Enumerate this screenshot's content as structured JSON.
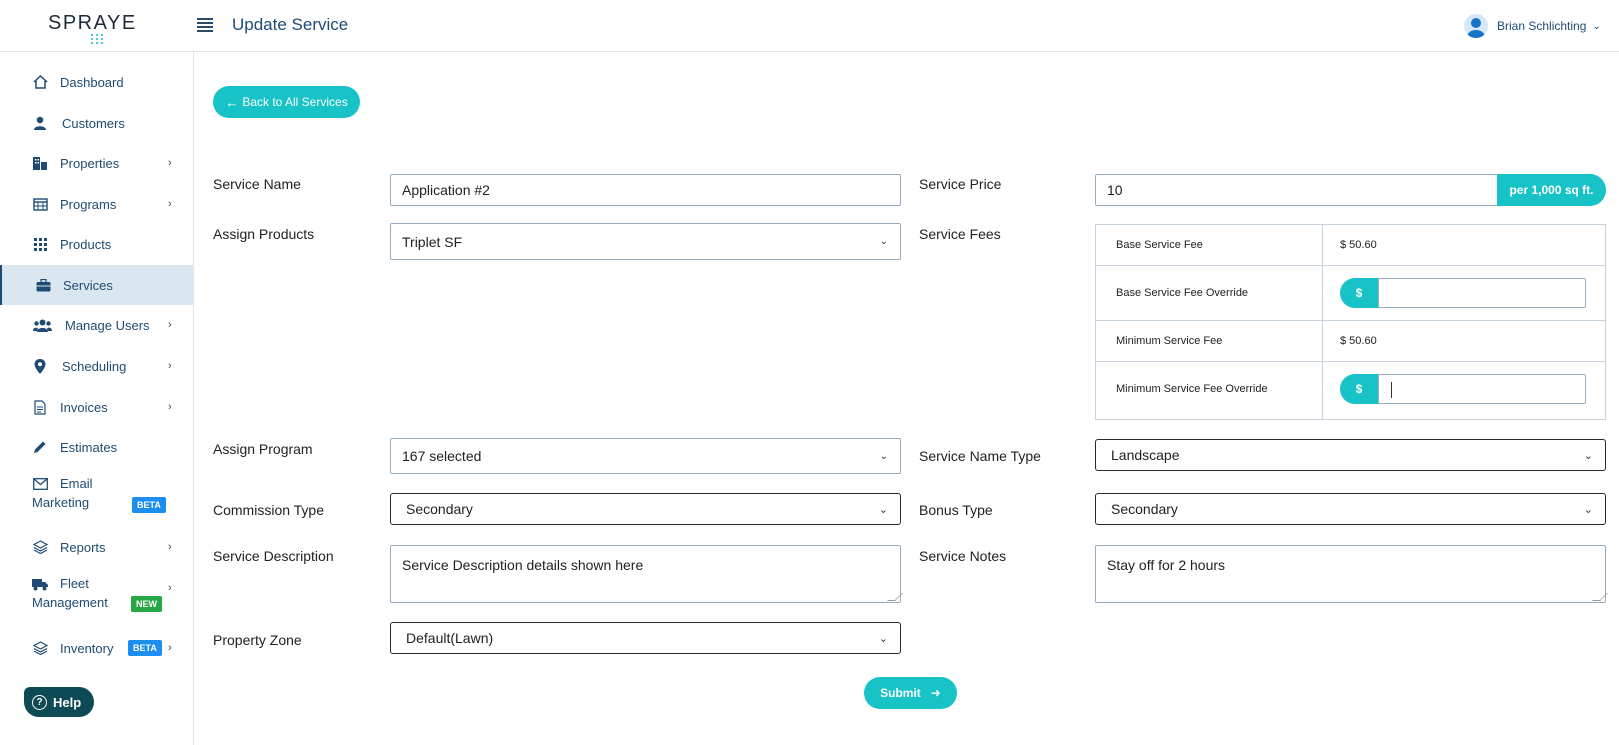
{
  "header": {
    "logo": "SPRAYE",
    "title": "Update Service",
    "user_name": "Brian Schlichting"
  },
  "sidebar": {
    "items": [
      {
        "label": "Dashboard"
      },
      {
        "label": "Customers"
      },
      {
        "label": "Properties"
      },
      {
        "label": "Programs"
      },
      {
        "label": "Products"
      },
      {
        "label": "Services"
      },
      {
        "label": "Manage Users"
      },
      {
        "label": "Scheduling"
      },
      {
        "label": "Invoices"
      },
      {
        "label": "Estimates"
      },
      {
        "label_line1": "Email",
        "label_line2": "Marketing",
        "badge": "BETA"
      },
      {
        "label": "Reports"
      },
      {
        "label_line1": "Fleet",
        "label_line2": "Management",
        "badge": "NEW"
      },
      {
        "label": "Inventory",
        "badge": "BETA"
      }
    ],
    "help": "Help"
  },
  "form": {
    "back_label": "Back to All Services",
    "service_name_label": "Service Name",
    "service_name_value": "Application #2",
    "service_price_label": "Service Price",
    "service_price_value": "10",
    "price_unit": "per 1,000 sq ft.",
    "assign_products_label": "Assign Products",
    "assign_products_value": "Triplet SF",
    "service_fees_label": "Service Fees",
    "fees": {
      "base_label": "Base Service Fee",
      "base_value": "$ 50.60",
      "base_override_label": "Base Service Fee Override",
      "min_label": "Minimum Service Fee",
      "min_value": "$ 50.60",
      "min_override_label": "Minimum Service Fee Override",
      "currency": "$"
    },
    "assign_program_label": "Assign Program",
    "assign_program_value": "167 selected",
    "service_name_type_label": "Service Name Type",
    "service_name_type_value": "Landscape",
    "commission_type_label": "Commission Type",
    "commission_type_value": "Secondary",
    "bonus_type_label": "Bonus Type",
    "bonus_type_value": "Secondary",
    "service_description_label": "Service Description",
    "service_description_value": "Service Description details shown here",
    "service_notes_label": "Service Notes",
    "service_notes_value": "Stay off for 2 hours",
    "property_zone_label": "Property Zone",
    "property_zone_value": "Default(Lawn)",
    "submit_label": "Submit"
  },
  "colors": {
    "accent": "#17c3c6",
    "nav_text": "#1f4b73",
    "active_bg": "#dae7f1",
    "help_bg": "#0e4a55",
    "beta_badge": "#1b8ef0",
    "new_badge": "#28a745"
  }
}
